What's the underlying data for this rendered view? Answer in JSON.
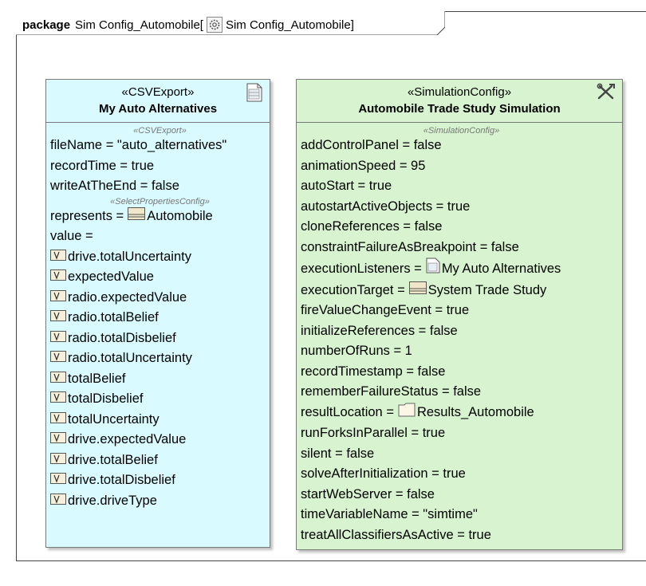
{
  "frame": {
    "keyword": "package",
    "name": "Sim Config_Automobile[",
    "ref_name": "Sim Config_Automobile]"
  },
  "csv_block": {
    "stereotype": "«CSVExport»",
    "name": "My Auto Alternatives",
    "section1": "«CSVExport»",
    "props1": [
      "fileName = \"auto_alternatives\"",
      "recordTime = true",
      "writeAtTheEnd = false"
    ],
    "section2": "«SelectPropertiesConfig»",
    "represents_label": "represents =",
    "represents_value": "Automobile",
    "value_label": "value =",
    "values": [
      "drive.totalUncertainty",
      "expectedValue",
      "radio.expectedValue",
      "radio.totalBelief",
      "radio.totalDisbelief",
      "radio.totalUncertainty",
      "totalBelief",
      "totalDisbelief",
      "totalUncertainty",
      "drive.expectedValue",
      "drive.totalBelief",
      "drive.totalDisbelief",
      "drive.driveType"
    ]
  },
  "sim_block": {
    "stereotype": "«SimulationConfig»",
    "name": "Automobile Trade Study Simulation",
    "section": "«SimulationConfig»",
    "props_a": [
      "addControlPanel = false",
      "animationSpeed = 95",
      "autoStart = true",
      "autostartActiveObjects = true",
      "cloneReferences = false",
      "constraintFailureAsBreakpoint = false"
    ],
    "exec_listeners_label": "executionListeners =",
    "exec_listeners_value": "My Auto Alternatives",
    "exec_target_label": "executionTarget =",
    "exec_target_value": "System Trade Study",
    "props_b": [
      "fireValueChangeEvent = true",
      "initializeReferences = false",
      "numberOfRuns = 1",
      "recordTimestamp = false",
      "rememberFailureStatus = false"
    ],
    "result_location_label": "resultLocation =",
    "result_location_value": "Results_Automobile",
    "props_c": [
      "runForksInParallel = true",
      "silent = false",
      "solveAfterInitialization = true",
      "startWebServer = false",
      "timeVariableName = \"simtime\"",
      "treatAllClassifiersAsActive = true"
    ]
  },
  "icons": {
    "csv": "csv-file-icon",
    "tools": "tools-icon",
    "block": "block-icon",
    "value": "value-property-icon",
    "folder": "folder-icon",
    "gear": "gear-icon"
  }
}
